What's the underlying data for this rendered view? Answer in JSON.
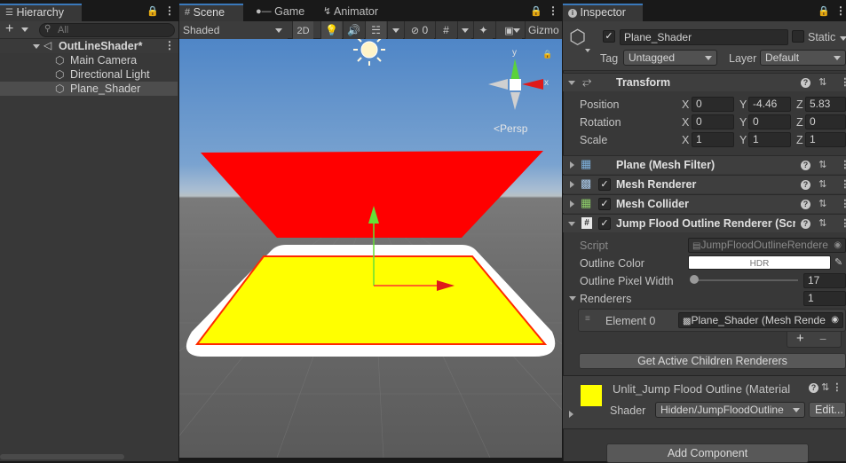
{
  "hierarchy": {
    "tab": "Hierarchy",
    "search_placeholder": "All",
    "scene": "OutLineShader*",
    "items": [
      "Main Camera",
      "Directional Light",
      "Plane_Shader"
    ]
  },
  "scene_tabs": {
    "scene": "Scene",
    "game": "Game",
    "animator": "Animator"
  },
  "scene_toolbar": {
    "shading": "Shaded",
    "mode_2d": "2D",
    "hidden_count": "0",
    "gizmos": "Gizmo"
  },
  "scene_view": {
    "persp": "Persp",
    "axis_x": "x",
    "axis_y": "y"
  },
  "inspector": {
    "tab": "Inspector",
    "object_name": "Plane_Shader",
    "static_label": "Static",
    "tag_label": "Tag",
    "tag_value": "Untagged",
    "layer_label": "Layer",
    "layer_value": "Default",
    "transform": {
      "title": "Transform",
      "position_label": "Position",
      "rotation_label": "Rotation",
      "scale_label": "Scale",
      "axis_x": "X",
      "axis_y": "Y",
      "axis_z": "Z",
      "position": [
        "0",
        "-4.46",
        "5.83"
      ],
      "rotation": [
        "0",
        "0",
        "0"
      ],
      "scale": [
        "1",
        "1",
        "1"
      ]
    },
    "components": [
      "Plane (Mesh Filter)",
      "Mesh Renderer",
      "Mesh Collider",
      "Jump Flood Outline Renderer (Scri"
    ],
    "jfor": {
      "script_label": "Script",
      "script_value": "JumpFloodOutlineRendere",
      "color_label": "Outline Color",
      "color_hdr": "HDR",
      "outline_color": "#ffffff",
      "width_label": "Outline Pixel Width",
      "width_value": "17",
      "renderers_label": "Renderers",
      "renderers_count": "1",
      "element_label": "Element 0",
      "element_value": "Plane_Shader (Mesh Rende",
      "plus": "+",
      "minus": "−",
      "get_children_button": "Get Active Children Renderers"
    },
    "material": {
      "name": "Unlit_Jump Flood Outline (Material",
      "swatch_color": "#ffff00",
      "shader_label": "Shader",
      "shader_value": "Hidden/JumpFloodOutline",
      "edit_button": "Edit..."
    },
    "add_component_button": "Add Component"
  }
}
